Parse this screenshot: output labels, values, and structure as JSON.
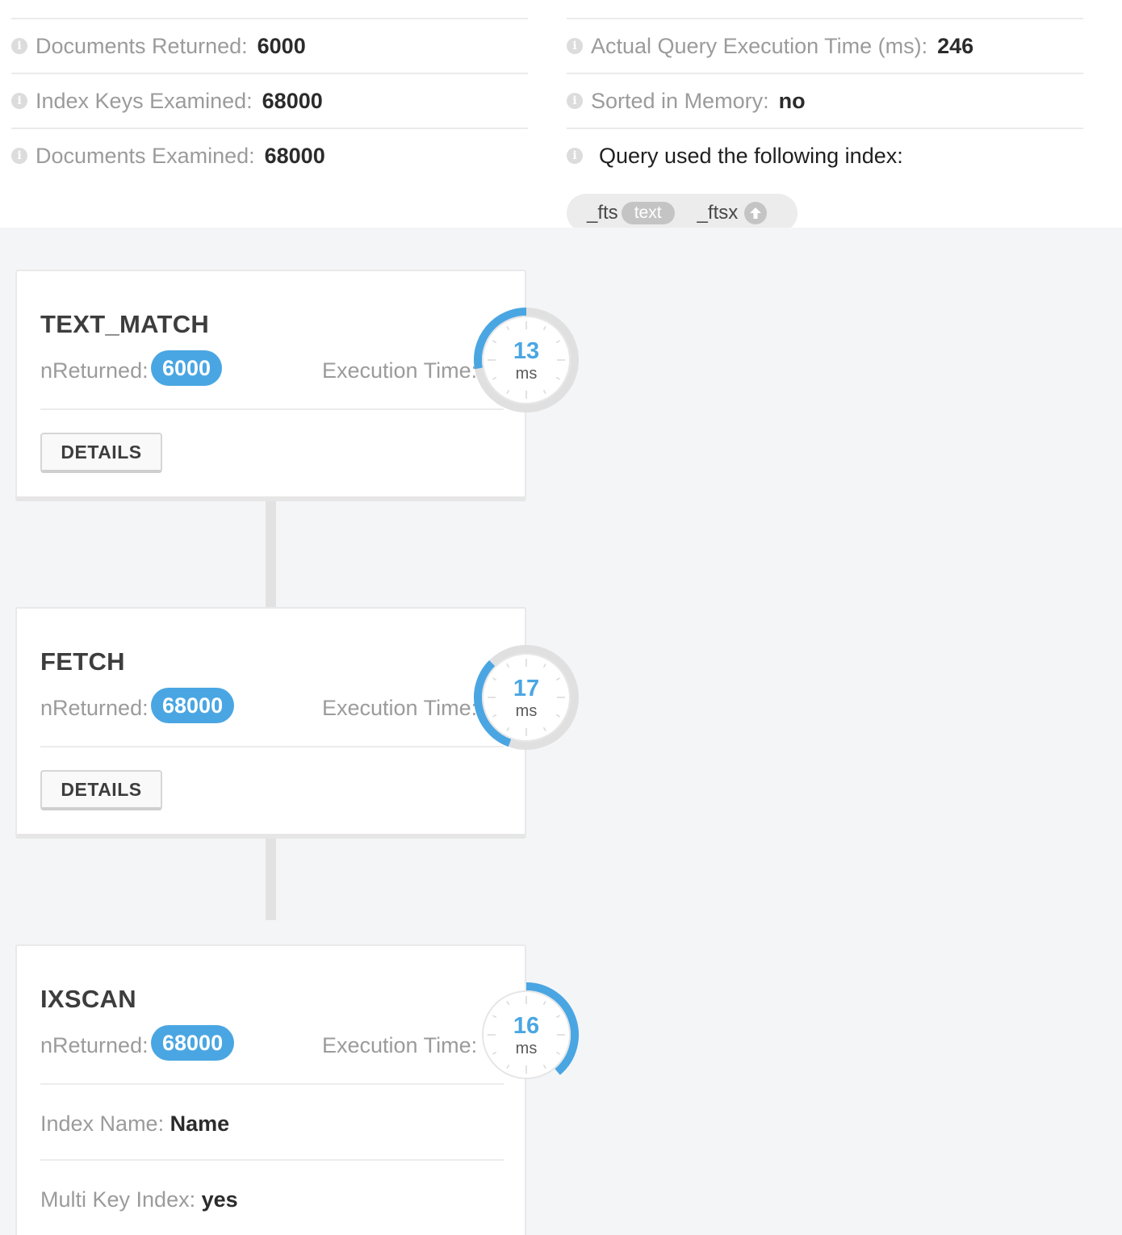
{
  "summary": {
    "left": [
      {
        "label": "Documents Returned:",
        "value": "6000"
      },
      {
        "label": "Index Keys Examined:",
        "value": "68000"
      },
      {
        "label": "Documents Examined:",
        "value": "68000"
      }
    ],
    "right": [
      {
        "label": "Actual Query Execution Time (ms):",
        "value": "246"
      },
      {
        "label": "Sorted in Memory:",
        "value": "no"
      }
    ],
    "index_heading": "Query used the following index:",
    "index_pill": {
      "field1": "_fts",
      "type1": "text",
      "field2": "_ftsx",
      "direction2_icon": "arrow-up-icon"
    },
    "info_icon_glyph": "i"
  },
  "stages": [
    {
      "title": "TEXT_MATCH",
      "nreturned_label": "nReturned:",
      "nreturned": "6000",
      "exec_label": "Execution Time:",
      "exec_ms": "13",
      "exec_unit": "ms",
      "button": "DETAILS"
    },
    {
      "title": "FETCH",
      "nreturned_label": "nReturned:",
      "nreturned": "68000",
      "exec_label": "Execution Time:",
      "exec_ms": "17",
      "exec_unit": "ms",
      "button": "DETAILS"
    },
    {
      "title": "IXSCAN",
      "nreturned_label": "nReturned:",
      "nreturned": "68000",
      "exec_label": "Execution Time:",
      "exec_ms": "16",
      "exec_unit": "ms",
      "index_name_label": "Index Name:",
      "index_name": "Name",
      "multikey_label": "Multi Key Index:",
      "multikey": "yes"
    }
  ],
  "colors": {
    "accent": "#4aa6e2",
    "muted_label": "#9b9b9b",
    "tree_background": "#f4f5f7"
  }
}
